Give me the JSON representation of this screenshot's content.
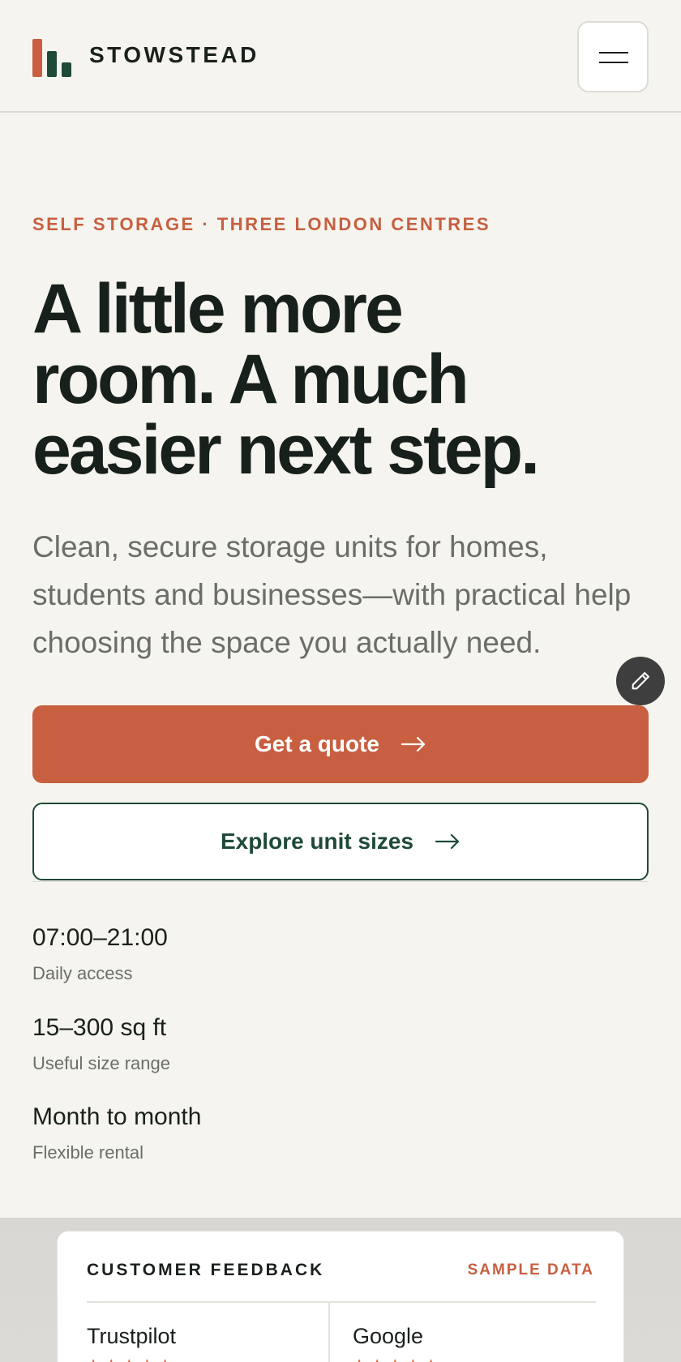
{
  "header": {
    "brand": "STOWSTEAD",
    "menu_label": "Open menu"
  },
  "hero": {
    "eyebrow": "SELF STORAGE · THREE LONDON CENTRES",
    "headline_lines": [
      "A little more",
      "room. A much",
      "easier next step."
    ],
    "lede": "Clean, secure storage units for homes, students and businesses—with practical help choosing the space you actually need.",
    "primary_cta": "Get a quote",
    "secondary_cta": "Explore unit sizes"
  },
  "stats": [
    {
      "value": "07:00–21:00",
      "label": "Daily access"
    },
    {
      "value": "15–300 sq ft",
      "label": "Useful size range"
    },
    {
      "value": "Month to month",
      "label": "Flexible rental"
    }
  ],
  "feedback": {
    "title": "CUSTOMER FEEDBACK",
    "badge": "SAMPLE DATA",
    "sources": [
      {
        "name": "Trustpilot",
        "stars": "★★★★★"
      },
      {
        "name": "Google",
        "stars": "★★★★★"
      }
    ]
  },
  "colors": {
    "background": "#f5f4ef",
    "accent": "#c75f40",
    "brand_green": "#1f4a38",
    "text": "#1a201c",
    "muted": "#6b6e68"
  },
  "icons": {
    "logo": "logo-bars-icon",
    "menu": "hamburger-menu-icon",
    "edit": "pencil-icon",
    "arrow": "arrow-right-icon"
  }
}
